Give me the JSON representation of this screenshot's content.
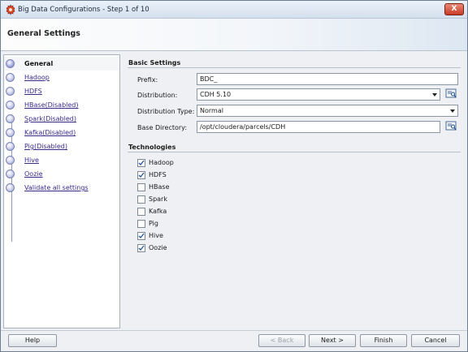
{
  "window": {
    "title": "Big Data Configurations - Step 1 of 10",
    "close_label": "X"
  },
  "header": {
    "title": "General Settings"
  },
  "nav": {
    "items": [
      {
        "label": "General",
        "active": true
      },
      {
        "label": "Hadoop"
      },
      {
        "label": "HDFS"
      },
      {
        "label": "HBase(Disabled)"
      },
      {
        "label": "Spark(Disabled)"
      },
      {
        "label": "Kafka(Disabled)"
      },
      {
        "label": "Pig(Disabled)"
      },
      {
        "label": "Hive"
      },
      {
        "label": "Oozie"
      },
      {
        "label": "Validate all settings"
      }
    ]
  },
  "basic": {
    "title": "Basic Settings",
    "prefix_label": "Prefix:",
    "prefix_value": "BDC_",
    "distribution_label": "Distribution:",
    "distribution_value": "CDH 5.10",
    "distribution_type_label": "Distribution Type:",
    "distribution_type_value": "Normal",
    "base_dir_label": "Base Directory:",
    "base_dir_value": "/opt/cloudera/parcels/CDH"
  },
  "technologies": {
    "title": "Technologies",
    "items": [
      {
        "label": "Hadoop",
        "checked": true
      },
      {
        "label": "HDFS",
        "checked": true
      },
      {
        "label": "HBase",
        "checked": false
      },
      {
        "label": "Spark",
        "checked": false
      },
      {
        "label": "Kafka",
        "checked": false
      },
      {
        "label": "Pig",
        "checked": false
      },
      {
        "label": "Hive",
        "checked": true
      },
      {
        "label": "Oozie",
        "checked": true
      }
    ]
  },
  "footer": {
    "help": "Help",
    "back": "< Back",
    "next": "Next >",
    "finish": "Finish",
    "cancel": "Cancel"
  },
  "icons": {
    "app": "gear-app-icon",
    "browse": "browse-icon",
    "check": "checkmark-icon",
    "dropdown": "chevron-down-icon"
  },
  "colors": {
    "link": "#3a2a8a",
    "close_button": "#c73b24",
    "checkmark": "#2a5a9a"
  }
}
